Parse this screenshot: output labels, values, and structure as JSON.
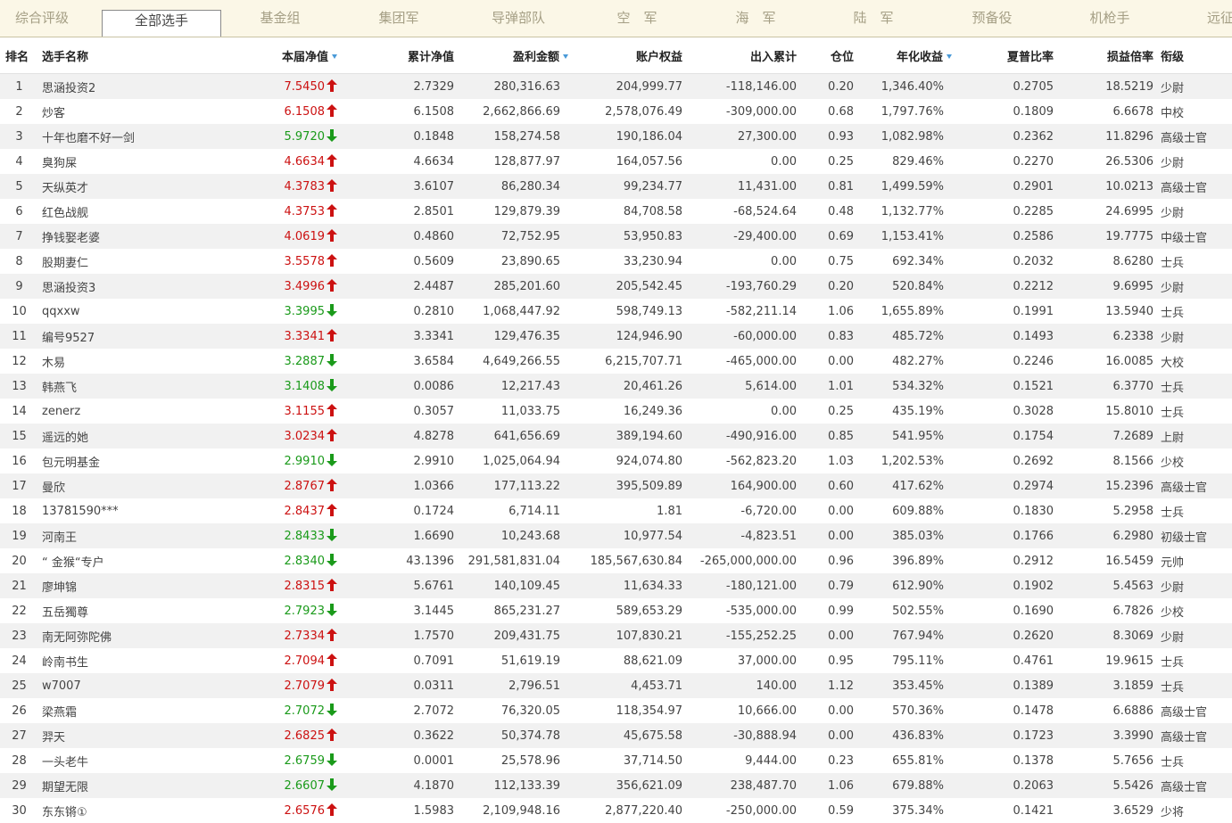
{
  "tabs": [
    {
      "label": "综合评级",
      "active": false
    },
    {
      "label": "全部选手",
      "active": true
    },
    {
      "label": "基金组",
      "active": false
    },
    {
      "label": "集团军",
      "active": false
    },
    {
      "label": "导弹部队",
      "active": false
    },
    {
      "label": "空　军",
      "active": false
    },
    {
      "label": "海　军",
      "active": false
    },
    {
      "label": "陆　军",
      "active": false
    },
    {
      "label": "预备役",
      "active": false
    },
    {
      "label": "机枪手",
      "active": false
    },
    {
      "label": "远征",
      "active": false
    }
  ],
  "headers": {
    "rank": "排名",
    "name": "选手名称",
    "nav": "本届净值",
    "cum_nav": "累计净值",
    "profit": "盈利金额",
    "equity": "账户权益",
    "flow": "出入累计",
    "position": "仓位",
    "annual": "年化收益",
    "sharpe": "夏普比率",
    "pl_ratio": "损益倍率",
    "title": "衔级"
  },
  "sort_marked_columns": [
    "nav",
    "profit",
    "annual"
  ],
  "colors": {
    "up": "#cc1111",
    "down": "#1a9a1a",
    "sort": "#4a9ad8",
    "tab_bg": "#fbf7e7",
    "stripe": "#f1f1f1"
  },
  "rows": [
    {
      "rank": "1",
      "name": "思涵投资2",
      "nav": "7.5450",
      "trend": "up",
      "cum_nav": "2.7329",
      "profit": "280,316.63",
      "equity": "204,999.77",
      "flow": "-118,146.00",
      "position": "0.20",
      "annual": "1,346.40%",
      "sharpe": "0.2705",
      "pl_ratio": "18.5219",
      "title": "少尉"
    },
    {
      "rank": "2",
      "name": "炒客",
      "nav": "6.1508",
      "trend": "up",
      "cum_nav": "6.1508",
      "profit": "2,662,866.69",
      "equity": "2,578,076.49",
      "flow": "-309,000.00",
      "position": "0.68",
      "annual": "1,797.76%",
      "sharpe": "0.1809",
      "pl_ratio": "6.6678",
      "title": "中校"
    },
    {
      "rank": "3",
      "name": "十年也磨不好一剑",
      "nav": "5.9720",
      "trend": "down",
      "cum_nav": "0.1848",
      "profit": "158,274.58",
      "equity": "190,186.04",
      "flow": "27,300.00",
      "position": "0.93",
      "annual": "1,082.98%",
      "sharpe": "0.2362",
      "pl_ratio": "11.8296",
      "title": "高级士官"
    },
    {
      "rank": "4",
      "name": "臭狗屎",
      "nav": "4.6634",
      "trend": "up",
      "cum_nav": "4.6634",
      "profit": "128,877.97",
      "equity": "164,057.56",
      "flow": "0.00",
      "position": "0.25",
      "annual": "829.46%",
      "sharpe": "0.2270",
      "pl_ratio": "26.5306",
      "title": "少尉"
    },
    {
      "rank": "5",
      "name": "天纵英才",
      "nav": "4.3783",
      "trend": "up",
      "cum_nav": "3.6107",
      "profit": "86,280.34",
      "equity": "99,234.77",
      "flow": "11,431.00",
      "position": "0.81",
      "annual": "1,499.59%",
      "sharpe": "0.2901",
      "pl_ratio": "10.0213",
      "title": "高级士官"
    },
    {
      "rank": "6",
      "name": "红色战舰",
      "nav": "4.3753",
      "trend": "up",
      "cum_nav": "2.8501",
      "profit": "129,879.39",
      "equity": "84,708.58",
      "flow": "-68,524.64",
      "position": "0.48",
      "annual": "1,132.77%",
      "sharpe": "0.2285",
      "pl_ratio": "24.6995",
      "title": "少尉"
    },
    {
      "rank": "7",
      "name": "挣钱娶老婆",
      "nav": "4.0619",
      "trend": "up",
      "cum_nav": "0.4860",
      "profit": "72,752.95",
      "equity": "53,950.83",
      "flow": "-29,400.00",
      "position": "0.69",
      "annual": "1,153.41%",
      "sharpe": "0.2586",
      "pl_ratio": "19.7775",
      "title": "中级士官"
    },
    {
      "rank": "8",
      "name": "股期妻仁",
      "nav": "3.5578",
      "trend": "up",
      "cum_nav": "0.5609",
      "profit": "23,890.65",
      "equity": "33,230.94",
      "flow": "0.00",
      "position": "0.75",
      "annual": "692.34%",
      "sharpe": "0.2032",
      "pl_ratio": "8.6280",
      "title": "士兵"
    },
    {
      "rank": "9",
      "name": "思涵投资3",
      "nav": "3.4996",
      "trend": "up",
      "cum_nav": "2.4487",
      "profit": "285,201.60",
      "equity": "205,542.45",
      "flow": "-193,760.29",
      "position": "0.20",
      "annual": "520.84%",
      "sharpe": "0.2212",
      "pl_ratio": "9.6995",
      "title": "少尉"
    },
    {
      "rank": "10",
      "name": "qqxxw",
      "nav": "3.3995",
      "trend": "down",
      "cum_nav": "0.2810",
      "profit": "1,068,447.92",
      "equity": "598,749.13",
      "flow": "-582,211.14",
      "position": "1.06",
      "annual": "1,655.89%",
      "sharpe": "0.1991",
      "pl_ratio": "13.5940",
      "title": "士兵"
    },
    {
      "rank": "11",
      "name": "编号9527",
      "nav": "3.3341",
      "trend": "up",
      "cum_nav": "3.3341",
      "profit": "129,476.35",
      "equity": "124,946.90",
      "flow": "-60,000.00",
      "position": "0.83",
      "annual": "485.72%",
      "sharpe": "0.1493",
      "pl_ratio": "6.2338",
      "title": "少尉"
    },
    {
      "rank": "12",
      "name": "木易",
      "nav": "3.2887",
      "trend": "down",
      "cum_nav": "3.6584",
      "profit": "4,649,266.55",
      "equity": "6,215,707.71",
      "flow": "-465,000.00",
      "position": "0.00",
      "annual": "482.27%",
      "sharpe": "0.2246",
      "pl_ratio": "16.0085",
      "title": "大校"
    },
    {
      "rank": "13",
      "name": "韩燕飞",
      "nav": "3.1408",
      "trend": "down",
      "cum_nav": "0.0086",
      "profit": "12,217.43",
      "equity": "20,461.26",
      "flow": "5,614.00",
      "position": "1.01",
      "annual": "534.32%",
      "sharpe": "0.1521",
      "pl_ratio": "6.3770",
      "title": "士兵"
    },
    {
      "rank": "14",
      "name": "zenerz",
      "nav": "3.1155",
      "trend": "up",
      "cum_nav": "0.3057",
      "profit": "11,033.75",
      "equity": "16,249.36",
      "flow": "0.00",
      "position": "0.25",
      "annual": "435.19%",
      "sharpe": "0.3028",
      "pl_ratio": "15.8010",
      "title": "士兵"
    },
    {
      "rank": "15",
      "name": "遥远的她",
      "nav": "3.0234",
      "trend": "up",
      "cum_nav": "4.8278",
      "profit": "641,656.69",
      "equity": "389,194.60",
      "flow": "-490,916.00",
      "position": "0.85",
      "annual": "541.95%",
      "sharpe": "0.1754",
      "pl_ratio": "7.2689",
      "title": "上尉"
    },
    {
      "rank": "16",
      "name": "包元明基金",
      "nav": "2.9910",
      "trend": "down",
      "cum_nav": "2.9910",
      "profit": "1,025,064.94",
      "equity": "924,074.80",
      "flow": "-562,823.20",
      "position": "1.03",
      "annual": "1,202.53%",
      "sharpe": "0.2692",
      "pl_ratio": "8.1566",
      "title": "少校"
    },
    {
      "rank": "17",
      "name": "曼欣",
      "nav": "2.8767",
      "trend": "up",
      "cum_nav": "1.0366",
      "profit": "177,113.22",
      "equity": "395,509.89",
      "flow": "164,900.00",
      "position": "0.60",
      "annual": "417.62%",
      "sharpe": "0.2974",
      "pl_ratio": "15.2396",
      "title": "高级士官"
    },
    {
      "rank": "18",
      "name": "13781590***",
      "nav": "2.8437",
      "trend": "up",
      "cum_nav": "0.1724",
      "profit": "6,714.11",
      "equity": "1.81",
      "flow": "-6,720.00",
      "position": "0.00",
      "annual": "609.88%",
      "sharpe": "0.1830",
      "pl_ratio": "5.2958",
      "title": "士兵"
    },
    {
      "rank": "19",
      "name": "河南王",
      "nav": "2.8433",
      "trend": "down",
      "cum_nav": "1.6690",
      "profit": "10,243.68",
      "equity": "10,977.54",
      "flow": "-4,823.51",
      "position": "0.00",
      "annual": "385.03%",
      "sharpe": "0.1766",
      "pl_ratio": "6.2980",
      "title": "初级士官"
    },
    {
      "rank": "20",
      "name": "“ 金猴“专户",
      "nav": "2.8340",
      "trend": "down",
      "cum_nav": "43.1396",
      "profit": "291,581,831.04",
      "equity": "185,567,630.84",
      "flow": "-265,000,000.00",
      "position": "0.96",
      "annual": "396.89%",
      "sharpe": "0.2912",
      "pl_ratio": "16.5459",
      "title": "元帅"
    },
    {
      "rank": "21",
      "name": "廖坤锦",
      "nav": "2.8315",
      "trend": "up",
      "cum_nav": "5.6761",
      "profit": "140,109.45",
      "equity": "11,634.33",
      "flow": "-180,121.00",
      "position": "0.79",
      "annual": "612.90%",
      "sharpe": "0.1902",
      "pl_ratio": "5.4563",
      "title": "少尉"
    },
    {
      "rank": "22",
      "name": "五岳獨尊",
      "nav": "2.7923",
      "trend": "down",
      "cum_nav": "3.1445",
      "profit": "865,231.27",
      "equity": "589,653.29",
      "flow": "-535,000.00",
      "position": "0.99",
      "annual": "502.55%",
      "sharpe": "0.1690",
      "pl_ratio": "6.7826",
      "title": "少校"
    },
    {
      "rank": "23",
      "name": "南无阿弥陀佛",
      "nav": "2.7334",
      "trend": "up",
      "cum_nav": "1.7570",
      "profit": "209,431.75",
      "equity": "107,830.21",
      "flow": "-155,252.25",
      "position": "0.00",
      "annual": "767.94%",
      "sharpe": "0.2620",
      "pl_ratio": "8.3069",
      "title": "少尉"
    },
    {
      "rank": "24",
      "name": "岭南书生",
      "nav": "2.7094",
      "trend": "up",
      "cum_nav": "0.7091",
      "profit": "51,619.19",
      "equity": "88,621.09",
      "flow": "37,000.00",
      "position": "0.95",
      "annual": "795.11%",
      "sharpe": "0.4761",
      "pl_ratio": "19.9615",
      "title": "士兵"
    },
    {
      "rank": "25",
      "name": "w7007",
      "nav": "2.7079",
      "trend": "up",
      "cum_nav": "0.0311",
      "profit": "2,796.51",
      "equity": "4,453.71",
      "flow": "140.00",
      "position": "1.12",
      "annual": "353.45%",
      "sharpe": "0.1389",
      "pl_ratio": "3.1859",
      "title": "士兵"
    },
    {
      "rank": "26",
      "name": "梁燕霜",
      "nav": "2.7072",
      "trend": "down",
      "cum_nav": "2.7072",
      "profit": "76,320.05",
      "equity": "118,354.97",
      "flow": "10,666.00",
      "position": "0.00",
      "annual": "570.36%",
      "sharpe": "0.1478",
      "pl_ratio": "6.6886",
      "title": "高级士官"
    },
    {
      "rank": "27",
      "name": "羿天",
      "nav": "2.6825",
      "trend": "up",
      "cum_nav": "0.3622",
      "profit": "50,374.78",
      "equity": "45,675.58",
      "flow": "-30,888.94",
      "position": "0.00",
      "annual": "436.83%",
      "sharpe": "0.1723",
      "pl_ratio": "3.3990",
      "title": "高级士官"
    },
    {
      "rank": "28",
      "name": "一头老牛",
      "nav": "2.6759",
      "trend": "down",
      "cum_nav": "0.0001",
      "profit": "25,578.96",
      "equity": "37,714.50",
      "flow": "9,444.00",
      "position": "0.23",
      "annual": "655.81%",
      "sharpe": "0.1378",
      "pl_ratio": "5.7656",
      "title": "士兵"
    },
    {
      "rank": "29",
      "name": "期望无限",
      "nav": "2.6607",
      "trend": "down",
      "cum_nav": "4.1870",
      "profit": "112,133.39",
      "equity": "356,621.09",
      "flow": "238,487.70",
      "position": "1.06",
      "annual": "679.88%",
      "sharpe": "0.2063",
      "pl_ratio": "5.5426",
      "title": "高级士官"
    },
    {
      "rank": "30",
      "name": "东东锵①",
      "nav": "2.6576",
      "trend": "up",
      "cum_nav": "1.5983",
      "profit": "2,109,948.16",
      "equity": "2,877,220.40",
      "flow": "-250,000.00",
      "position": "0.59",
      "annual": "375.34%",
      "sharpe": "0.1421",
      "pl_ratio": "3.6529",
      "title": "少将"
    }
  ]
}
